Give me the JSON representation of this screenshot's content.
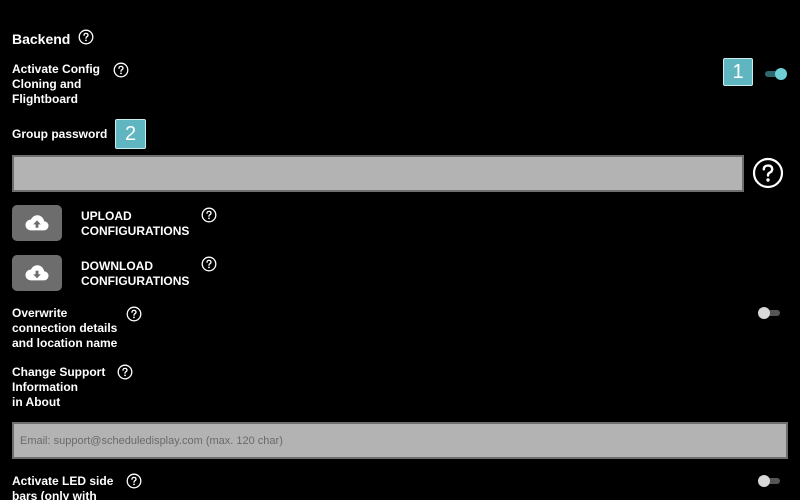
{
  "backend": {
    "title": "Backend"
  },
  "config_cloning": {
    "label": "Activate Config\nCloning and\nFlightboard",
    "badge": "1",
    "toggle_state": "on"
  },
  "group_password": {
    "label": "Group password",
    "badge": "2",
    "value": "",
    "placeholder": ""
  },
  "upload": {
    "label": "UPLOAD\nCONFIGURATIONS",
    "icon": "cloud-upload-icon"
  },
  "download": {
    "label": "DOWNLOAD\nCONFIGURATIONS",
    "icon": "cloud-download-icon"
  },
  "overwrite": {
    "label": "Overwrite\nconnection details\nand location name",
    "toggle_state": "off"
  },
  "support_info": {
    "label": "Change Support\nInformation\nin About",
    "placeholder": "Email: support@scheduledisplay.com (max. 120 char)"
  },
  "led_sidebars": {
    "label": "Activate LED side\nbars (only with",
    "toggle_state": "off"
  },
  "colors": {
    "accent": "#6fd0d6",
    "badge": "#5fb6c0",
    "button": "#6d6d6d",
    "field": "#b3b3b3"
  }
}
